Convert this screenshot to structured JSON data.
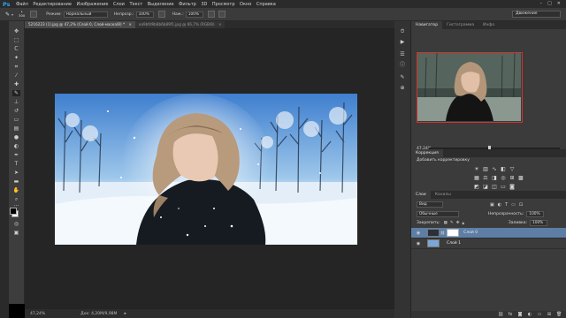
{
  "menubar": {
    "logo": "Ps",
    "items": [
      "Файл",
      "Редактирование",
      "Изображение",
      "Слои",
      "Текст",
      "Выделение",
      "Фильтр",
      "3D",
      "Просмотр",
      "Окно",
      "Справка"
    ]
  },
  "options": {
    "brush_size": "300",
    "mode_label": "Режим:",
    "mode_value": "Нормальный",
    "opacity_label": "Непрозр.:",
    "opacity_value": "100%",
    "flow_label": "Наж.:",
    "flow_value": "100%",
    "workspace": "Движение"
  },
  "tabs": [
    {
      "label": "5216223 (1).jpg @ 47,2% (Слой 0, Слой-маска/8) *",
      "active": true
    },
    {
      "label": "ea9bfd9b8b6b89f1.jpg @ 66,7% (RGB/8)",
      "active": false
    }
  ],
  "status": {
    "zoom": "47,24%",
    "doc": "Док: 4,20M/9,98M"
  },
  "navigator": {
    "tabs": [
      "Навигатор",
      "Гистограмма",
      "Инфо"
    ],
    "zoom": "47,24%",
    "zoom_fraction": 0.45
  },
  "correction": {
    "title": "Коррекция",
    "subtitle": "Добавить корректировку"
  },
  "layers": {
    "tabs": [
      "Слои",
      "Каналы"
    ],
    "kind_label": "Вид",
    "blend_mode": "Обычные",
    "opacity_label": "Непрозрачность:",
    "opacity_value": "100%",
    "lock_label": "Закрепить:",
    "fill_label": "Заливка:",
    "fill_value": "100%",
    "items": [
      {
        "name": "Слой 0",
        "selected": true
      },
      {
        "name": "Слой 1",
        "selected": false
      }
    ]
  },
  "colors": {
    "accent": "#2fa3e8",
    "selection": "#5d7fa6",
    "navigator_frame": "#d0342c"
  }
}
